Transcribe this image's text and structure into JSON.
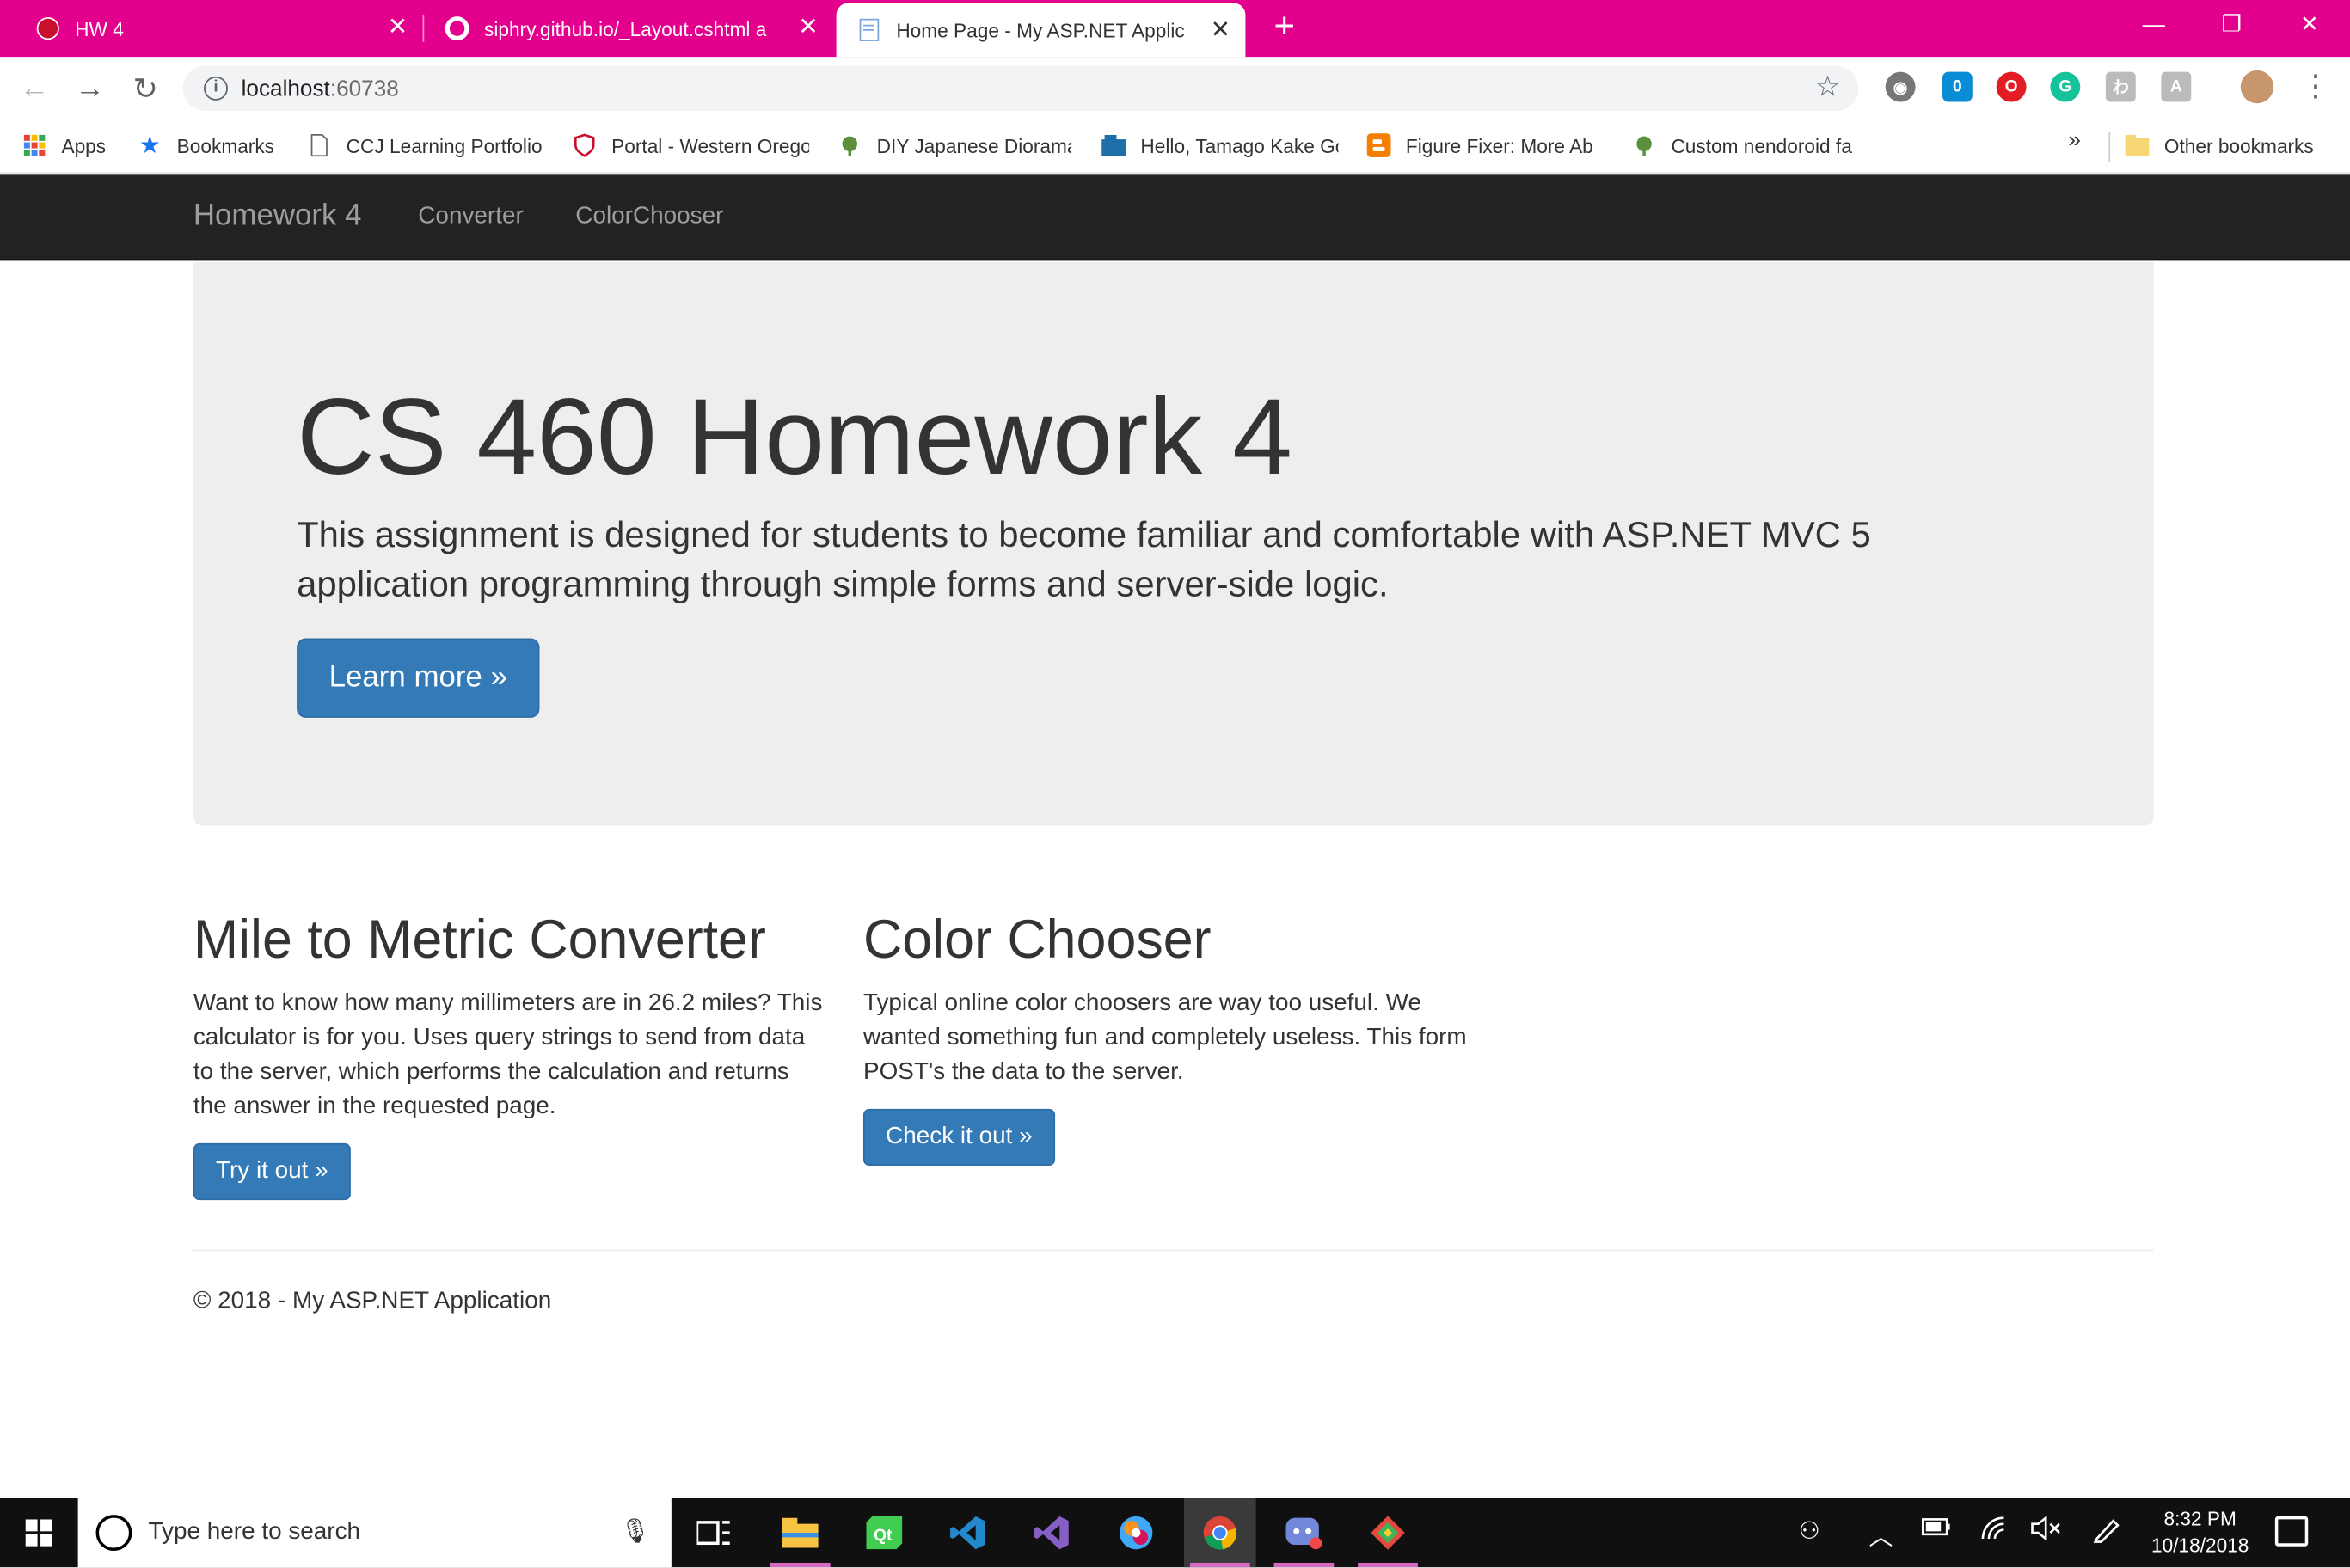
{
  "browser": {
    "tabs": [
      {
        "label": "HW 4",
        "icon": "hw-tab-icon"
      },
      {
        "label": "siphry.github.io/_Layout.cshtml a",
        "icon": "github-icon"
      },
      {
        "label": "Home Page - My ASP.NET Applic",
        "icon": "page-icon",
        "active": true
      }
    ],
    "close_glyph": "✕",
    "new_tab_glyph": "+",
    "window_controls": {
      "minimize": "—",
      "restore": "❐",
      "close": "✕"
    },
    "nav": {
      "back": "←",
      "forward": "→",
      "reload": "↻"
    },
    "address": {
      "host": "localhost",
      "rest": ":60738",
      "info_glyph": "i"
    },
    "star_glyph": "☆",
    "extensions": [
      {
        "name": "circle-extension-icon",
        "color": "#777777",
        "label": "◉"
      },
      {
        "name": "ghostery-extension-icon",
        "color": "#0a8bd6",
        "label": "0"
      },
      {
        "name": "opera-extension-icon",
        "color": "#e31b23",
        "label": "O"
      },
      {
        "name": "grammarly-extension-icon",
        "color": "#15c39a",
        "label": "G"
      },
      {
        "name": "translate-extension-icon",
        "color": "#bbbbbb",
        "label": "わ"
      },
      {
        "name": "pdf-extension-icon",
        "color": "#bbbbbb",
        "label": "A"
      },
      {
        "name": "profile-avatar-icon",
        "color": "#c7966c",
        "label": ""
      }
    ],
    "menu_glyph": "⋮"
  },
  "bookmarks": {
    "items": [
      {
        "label": "Apps",
        "icon": "apps-grid-icon"
      },
      {
        "label": "Bookmarks",
        "icon": "star-icon"
      },
      {
        "label": "CCJ Learning Portfolio",
        "icon": "document-icon"
      },
      {
        "label": "Portal - Western Oregon",
        "icon": "shield-icon"
      },
      {
        "label": "DIY Japanese Diorama",
        "icon": "leaf-icon"
      },
      {
        "label": "Hello, Tamago Kake Gohan",
        "icon": "folder-icon"
      },
      {
        "label": "Figure Fixer: More Ab",
        "icon": "blogger-icon"
      },
      {
        "label": "Custom nendoroid fa",
        "icon": "leaf-icon"
      }
    ],
    "more_glyph": "»",
    "other": "Other bookmarks"
  },
  "site": {
    "brand": "Homework 4",
    "nav": [
      "Converter",
      "ColorChooser"
    ],
    "jumbotron": {
      "title": "CS 460 Homework 4",
      "lead": "This assignment is designed for students to become familiar and comfortable with ASP.NET MVC 5 application programming through simple forms and server-side logic.",
      "button": "Learn more »"
    },
    "columns": [
      {
        "title": "Mile to Metric Converter",
        "text": "Want to know how many millimeters are in 26.2 miles? This calculator is for you. Uses query strings to send from data to the server, which performs the calculation and returns the answer in the requested page.",
        "button": "Try it out »"
      },
      {
        "title": "Color Chooser",
        "text": "Typical online color choosers are way too useful. We wanted something fun and completely useless. This form POST's the data to the server.",
        "button": "Check it out »"
      }
    ],
    "footer": "© 2018 - My ASP.NET Application"
  },
  "taskbar": {
    "search_placeholder": "Type here to search",
    "clock_time": "8:32 PM",
    "clock_date": "10/18/2018",
    "tray": [
      "people-icon",
      "chevron-up-icon",
      "battery-icon",
      "wifi-icon",
      "volume-muted-icon",
      "pen-icon"
    ]
  },
  "colors": {
    "tabstrip": "#e3008c",
    "navbar": "#222222",
    "primary_button": "#337ab7",
    "jumbotron": "#eeeeee"
  }
}
